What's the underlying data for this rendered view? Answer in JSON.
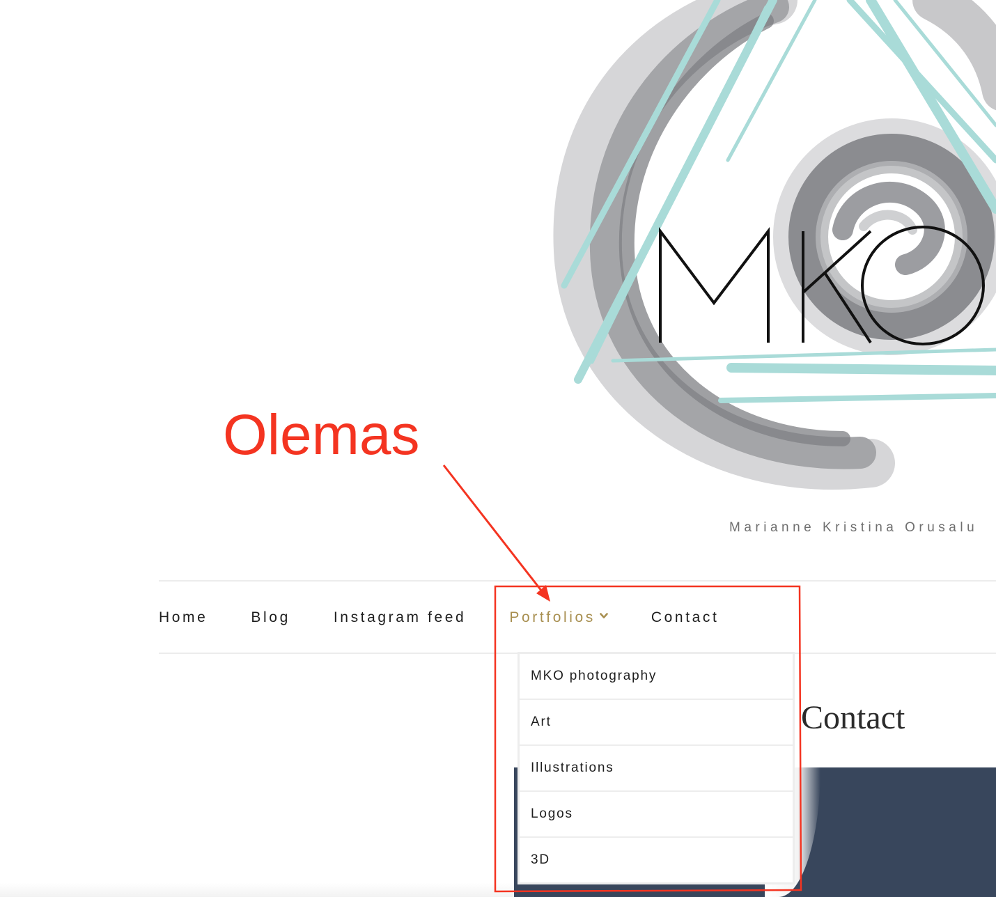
{
  "header": {
    "logo_text": "MKO",
    "tagline": "Marianne Kristina Orusalu"
  },
  "nav": {
    "items": [
      {
        "label": "Home",
        "active": false
      },
      {
        "label": "Blog",
        "active": false
      },
      {
        "label": "Instagram feed",
        "active": false
      },
      {
        "label": "Portfolios",
        "active": true,
        "has_dropdown": true,
        "icon": "chevron-down-icon"
      },
      {
        "label": "Contact",
        "active": false
      }
    ]
  },
  "dropdown": {
    "items": [
      {
        "label": "MKO photography"
      },
      {
        "label": "Art"
      },
      {
        "label": "Illustrations"
      },
      {
        "label": "Logos"
      },
      {
        "label": "3D"
      }
    ]
  },
  "main": {
    "heading": "Contact"
  },
  "annotation": {
    "label": "Olemas"
  },
  "colors": {
    "accent": "#a88f50",
    "annotation": "#f43421",
    "text": "#1e1e1e",
    "tagline": "#6f6f6f",
    "image_bg": "#38465c",
    "logo_teal": "#a9dbd8",
    "logo_gray": "#8e8f93"
  }
}
